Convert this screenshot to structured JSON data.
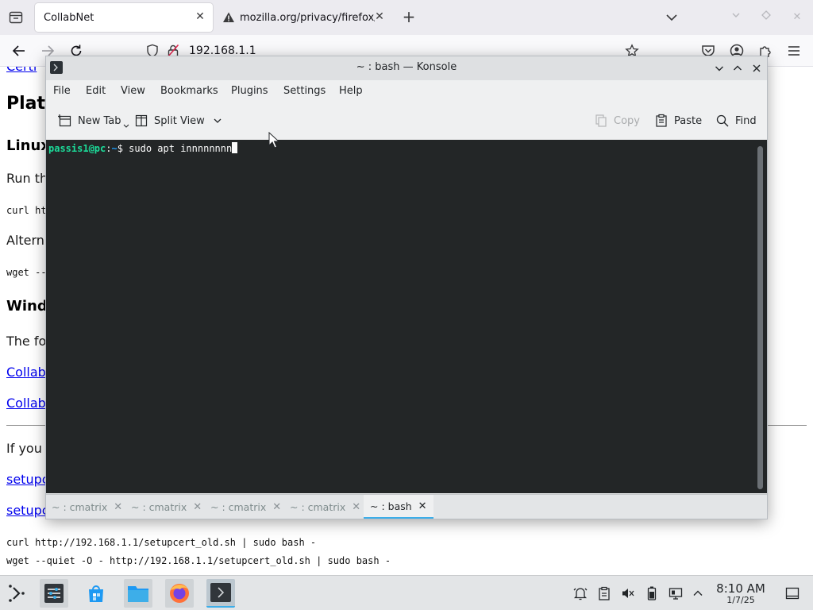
{
  "browser": {
    "tabs": [
      {
        "title": "CollabNet",
        "active": true
      },
      {
        "title": "mozilla.org/privacy/firefox/",
        "active": false
      }
    ],
    "url": "192.168.1.1"
  },
  "page": {
    "link_top": "Certi",
    "heading_platform": "Plat",
    "heading_linux": "Linux",
    "run_text": "Run th",
    "curl_partial": "curl ht",
    "alt_text": "Altern",
    "wget_partial": "wget --",
    "heading_windows": "Wind",
    "following_text": "The fo",
    "link_collab1": "Collab",
    "link_collab2": "Collab",
    "ifyou_text": "If you",
    "link_setup1": "setupc",
    "link_setup2": "setupc",
    "cmd_curl": "curl http://192.168.1.1/setupcert_old.sh | sudo bash -",
    "cmd_wget": "wget --quiet -O - http://192.168.1.1/setupcert_old.sh | sudo bash -"
  },
  "konsole": {
    "title": "~ : bash — Konsole",
    "menu": [
      "File",
      "Edit",
      "View",
      "Bookmarks",
      "Plugins",
      "Settings",
      "Help"
    ],
    "toolbar": {
      "new_tab": "New Tab",
      "split_view": "Split View",
      "copy": "Copy",
      "paste": "Paste",
      "find": "Find"
    },
    "prompt": {
      "user": "passis1@pc",
      "sep": ":",
      "path": "~",
      "symbol": "$ ",
      "command": "sudo apt innnnnnnn"
    },
    "tabs": [
      {
        "label": "~ : cmatrix",
        "active": false
      },
      {
        "label": "~ : cmatrix",
        "active": false
      },
      {
        "label": "~ : cmatrix",
        "active": false
      },
      {
        "label": "~ : cmatrix",
        "active": false
      },
      {
        "label": "~ : bash",
        "active": true
      }
    ]
  },
  "taskbar": {
    "time": "8:10 AM",
    "date": "1/7/25",
    "apps": [
      "application-launcher-icon",
      "system-settings-icon",
      "discover-store-icon",
      "dolphin-file-manager-icon",
      "firefox-icon",
      "konsole-icon"
    ]
  },
  "colors": {
    "konsole_bg": "#232627",
    "prompt_user": "#1cdc9a",
    "prompt_path": "#1d99f3",
    "accent": "#3daee9",
    "link": "#0000ee"
  }
}
